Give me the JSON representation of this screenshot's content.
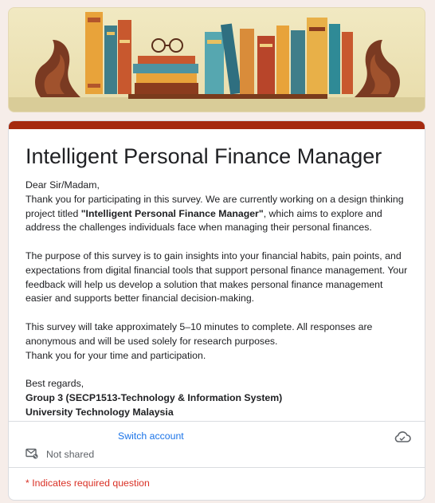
{
  "form": {
    "title": "Intelligent Personal Finance Manager",
    "greeting": "Dear Sir/Madam,",
    "intro_pre": "Thank you for participating in this survey. We are currently working on a design thinking project titled ",
    "intro_bold": "\"Intelligent Personal Finance Manager\"",
    "intro_post": ", which aims to explore and address the challenges individuals face when managing their personal finances.",
    "purpose": "The purpose of this survey is to gain insights into your financial habits, pain points, and expectations from digital financial tools that support personal finance management. Your feedback will help us develop a solution that makes personal finance management easier and supports better financial decision-making.",
    "duration": "This survey will take approximately 5–10 minutes to complete. All responses are anonymous and will be used solely for research purposes.",
    "thanks": "Thank you for your time and participation.",
    "closing": "Best regards,",
    "signature_group": "Group 3 (SECP1513-Technology & Information System)",
    "signature_university": "University Technology Malaysia"
  },
  "account": {
    "switch_label": "Switch account",
    "shared_status": "Not shared"
  },
  "required_note": "* Indicates required question",
  "colors": {
    "accent": "#a52a0f",
    "link": "#1a73e8",
    "required": "#d93025"
  },
  "icons": [
    "cloud-icon",
    "mail-not-shared-icon"
  ]
}
